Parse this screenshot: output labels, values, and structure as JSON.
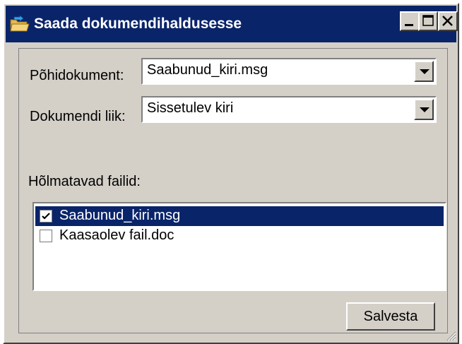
{
  "window": {
    "title": "Saada dokumendihaldusesse",
    "icon": "folder-arrow-icon"
  },
  "form": {
    "main_doc_label": "Põhidokument:",
    "main_doc_value": "Saabunud_kiri.msg",
    "doc_type_label": "Dokumendi liik:",
    "doc_type_value": "Sissetulev kiri",
    "files_label": "Hõlmatavad failid:"
  },
  "files": [
    {
      "name": "Saabunud_kiri.msg",
      "checked": true,
      "selected": true
    },
    {
      "name": "Kaasaolev fail.doc",
      "checked": false,
      "selected": false
    }
  ],
  "buttons": {
    "save": "Salvesta"
  },
  "colors": {
    "titlebar": "#0a246a",
    "face": "#d4d0c8",
    "selection": "#0a246a"
  }
}
